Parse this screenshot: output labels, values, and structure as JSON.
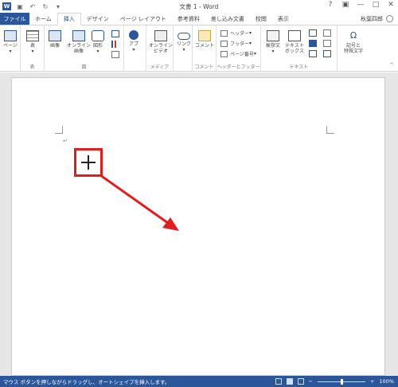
{
  "window": {
    "title": "文書 1 - Word",
    "app_logo": "W",
    "controls": [
      "?",
      "▣",
      "—",
      "□",
      "✕"
    ]
  },
  "quick_access": {
    "save_icon": "save-icon",
    "undo_icon": "undo-icon",
    "redo_icon": "redo-icon",
    "customize_icon": "customize-icon"
  },
  "tabs": [
    {
      "label": "ファイル"
    },
    {
      "label": "ホーム"
    },
    {
      "label": "挿入"
    },
    {
      "label": "デザイン"
    },
    {
      "label": "ページ レイアウト"
    },
    {
      "label": "参考資料"
    },
    {
      "label": "差し込み文書"
    },
    {
      "label": "校閲"
    },
    {
      "label": "表示"
    }
  ],
  "active_tab": "挿入",
  "user": {
    "name": "秋葉四郎"
  },
  "ribbon": {
    "page_btn": "ページ",
    "table_btn": "表",
    "table_group": "表",
    "image_btn": "画像",
    "online_image_btn_1": "オンライン",
    "online_image_btn_2": "画像",
    "shapes_btn": "図形",
    "figure_group": "図",
    "apps_btn": "アプ",
    "online_video_btn_1": "オンライン",
    "online_video_btn_2": "ビデオ",
    "media_group": "メディア",
    "link_btn": "リンク",
    "comment_btn": "コメント",
    "comment_group": "コメント",
    "header_btn": "ヘッダー",
    "footer_btn": "フッター",
    "page_number_btn": "ページ番号",
    "header_footer_group": "ヘッダーとフッター",
    "greeting_btn": "挨拶文",
    "textbox_btn_1": "テキスト",
    "textbox_btn_2": "ボックス",
    "text_group": "テキスト",
    "symbol_btn_1": "記号と",
    "symbol_btn_2": "特殊文字",
    "symbol_icon": "Ω"
  },
  "document": {
    "paragraph_mark": "↵",
    "cursor": "crosshair-cursor",
    "annotation_color": "#e21d1d"
  },
  "status_bar": {
    "message": "マウス ボタンを押しながらドラッグし、オートシェイプを挿入します。",
    "zoom": "100%",
    "color": "#2b579a"
  }
}
